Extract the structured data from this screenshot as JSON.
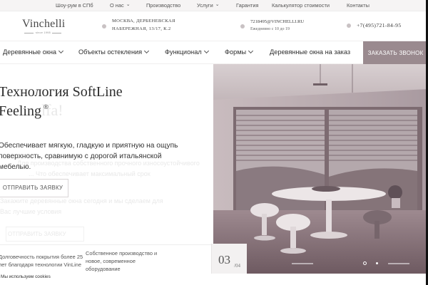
{
  "topbar": {
    "links": [
      "Шоу-рум в СПб",
      "О нас",
      "Производство",
      "Услуги",
      "Гарантия",
      "Калькулятор стоимости",
      "Контакты"
    ]
  },
  "header": {
    "logo": "Vinchelli",
    "logo_sub": "since 1998",
    "address_line1": "МОСКВА, ДЕРБЕНЕВСКАЯ",
    "address_line2": "НАБЕРЕЖНАЯ, 13/17, К.2",
    "email": "7218495@VINCHELLI.RU",
    "hours": "Ежедневно с 10 до 19",
    "phone": "+7(495)721-84-95"
  },
  "nav": {
    "items": [
      "Деревянные окна",
      "Объекты остекления",
      "Функционал",
      "Формы",
      "Деревянные окна на заказ"
    ],
    "cta": "ЗАКАЗАТЬ ЗВОНОК"
  },
  "hero": {
    "title_line1": "Технология SoftLine",
    "title_line2": "Feeling",
    "title_mark": "®",
    "ghost_title": "lfa!",
    "desc_line1": "Обеспечивает мягкую, гладкую и приятную на ощупь",
    "desc_line2": "поверхность, сравнимую с дорогой итальянской",
    "desc_line3": "мебелью.",
    "ghost_desc1": "Для производства собственного прочного износоустойчивого",
    "ghost_desc2": "... Что обеспечивает максимальный срок",
    "ghost_desc3": "Закажите деревянные окна сегодня и мы сделаем для",
    "ghost_desc4": "Вас лучшие условия",
    "button": "ОТПРАВИТЬ ЗАЯВКУ",
    "ghost_button": "ОТПРАВИТЬ ЗАЯВКУ",
    "features": {
      "f1_line1": "Долговечность покрытия более 25",
      "f1_line2": "лет благодаря технологии VinLine",
      "f2_line1": "Собственное производство и",
      "f2_line2": "новое, современное",
      "f2_line3": "оборудование"
    },
    "slide_current": "03",
    "slide_total": "/04"
  },
  "cookie": {
    "text": "Мы используем cookies"
  },
  "colors": {
    "accent": "#9a8a8f",
    "text": "#2e2e2e"
  }
}
